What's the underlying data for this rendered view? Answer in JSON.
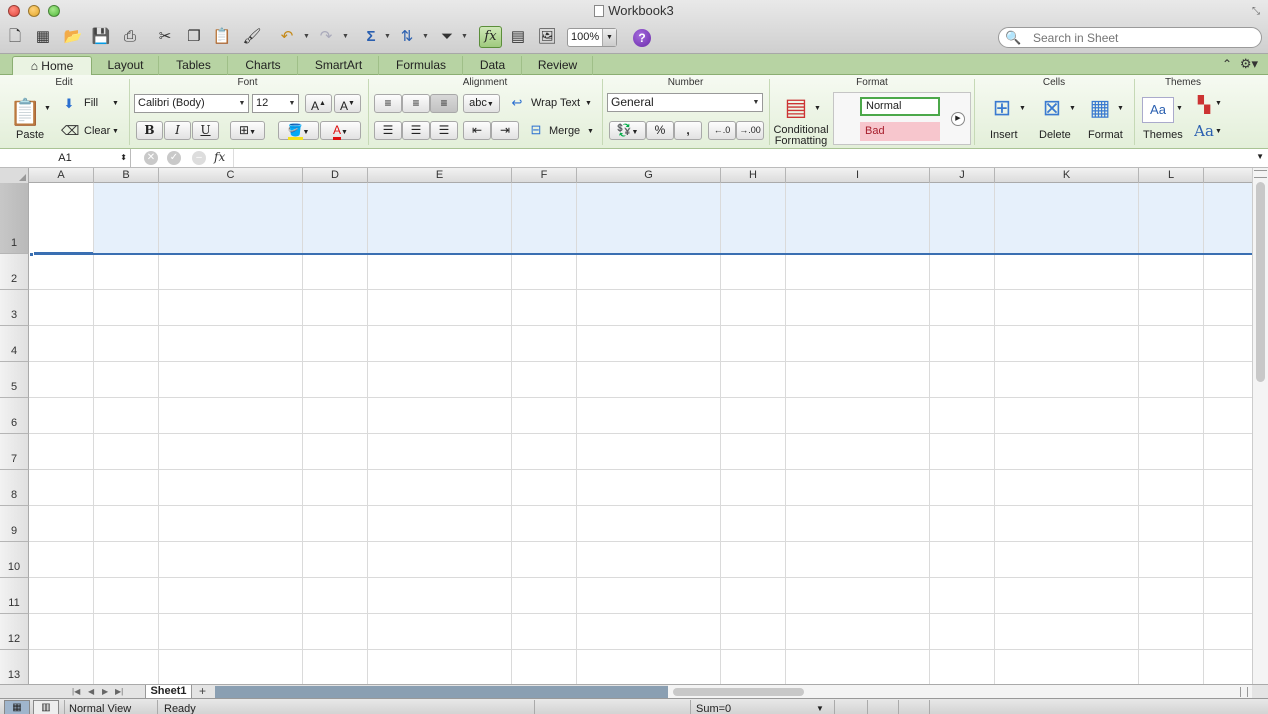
{
  "window": {
    "title": "Workbook3"
  },
  "toolbar": {
    "zoom": "100%",
    "help": "?",
    "fx": "fx"
  },
  "search": {
    "placeholder": "Search in Sheet"
  },
  "tabs": [
    "Home",
    "Layout",
    "Tables",
    "Charts",
    "SmartArt",
    "Formulas",
    "Data",
    "Review"
  ],
  "ribbon": {
    "groups": {
      "edit": "Edit",
      "font": "Font",
      "alignment": "Alignment",
      "number": "Number",
      "format": "Format",
      "cells": "Cells",
      "themes": "Themes"
    },
    "edit": {
      "paste": "Paste",
      "fill": "Fill",
      "clear": "Clear"
    },
    "font": {
      "name": "Calibri (Body)",
      "size": "12",
      "bold": "B",
      "italic": "I",
      "underline": "U",
      "grow": "A",
      "shrink": "A",
      "color_letter": "A"
    },
    "alignment": {
      "abc": "abc",
      "wrap": "Wrap Text",
      "merge": "Merge"
    },
    "number": {
      "format": "General",
      "percent": "%",
      "comma": ",",
      "inc_decimal": ".0",
      "dec_decimal": ".00"
    },
    "format": {
      "conditional_line1": "Conditional",
      "conditional_line2": "Formatting",
      "style_normal": "Normal",
      "style_bad": "Bad"
    },
    "cells": {
      "insert": "Insert",
      "delete": "Delete",
      "format": "Format"
    },
    "themes": {
      "themes": "Themes",
      "fonts": "Aa",
      "themes_icon": "Aa"
    }
  },
  "formula_bar": {
    "name_box": "A1",
    "fx": "fx",
    "value": ""
  },
  "grid": {
    "columns": [
      "A",
      "B",
      "C",
      "D",
      "E",
      "F",
      "G",
      "H",
      "I",
      "J",
      "K",
      "L"
    ],
    "rows": [
      "1",
      "2",
      "3",
      "4",
      "5",
      "6",
      "7",
      "8",
      "9",
      "10",
      "11",
      "12",
      "13"
    ],
    "active_cell": "A1"
  },
  "sheets": {
    "tabs": [
      "Sheet1"
    ],
    "add": "+"
  },
  "status": {
    "view": "Normal View",
    "state": "Ready",
    "sum": "Sum=0"
  },
  "colors": {
    "ribbon_green": "#b7d3a3",
    "selection_blue": "#3a6fb2",
    "row_highlight": "#e6f0fb",
    "style_bad_bg": "#f7c6cd"
  }
}
